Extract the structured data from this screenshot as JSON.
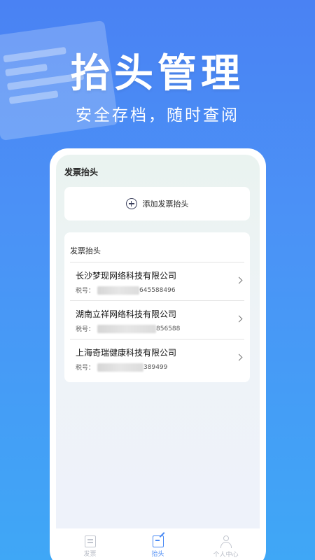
{
  "hero": {
    "title": "抬头管理",
    "subtitle": "安全存档，随时查阅"
  },
  "screen": {
    "title": "发票抬头",
    "add_label": "添加发票抬头",
    "list_header": "发票抬头",
    "items": [
      {
        "company": "长沙梦现网络科技有限公司",
        "tax_prefix": "税号：",
        "tax_tail": "645588496"
      },
      {
        "company": "湖南立祥网络科技有限公司",
        "tax_prefix": "税号：",
        "tax_tail": "856588"
      },
      {
        "company": "上海奇瑞健康科技有限公司",
        "tax_prefix": "税号：",
        "tax_tail": "389499"
      }
    ]
  },
  "tabbar": {
    "tabs": [
      {
        "label": "发票",
        "icon": "invoice-icon",
        "active": false
      },
      {
        "label": "抬头",
        "icon": "edit-icon",
        "active": true
      },
      {
        "label": "个人中心",
        "icon": "user-icon",
        "active": false
      }
    ]
  },
  "colors": {
    "accent": "#4a8af4",
    "background_top": "#4a82f3",
    "background_bottom": "#3fa7f6"
  }
}
